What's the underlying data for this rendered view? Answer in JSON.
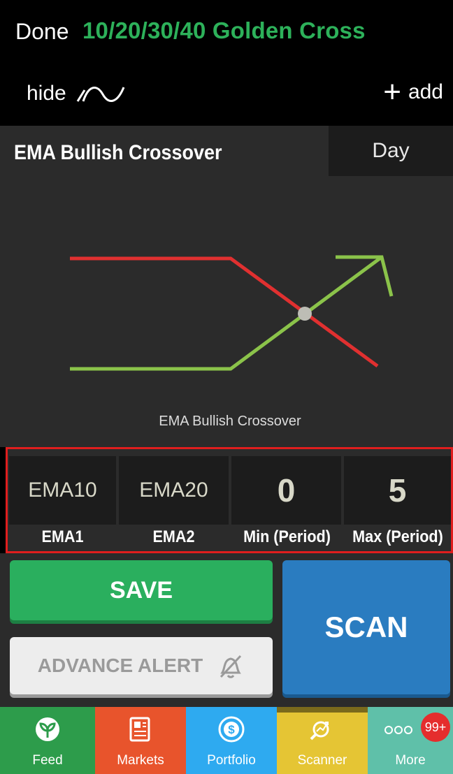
{
  "header": {
    "done_label": "Done",
    "strategy_title": "10/20/30/40 Golden Cross",
    "hide_label": "hide",
    "add_label": "add"
  },
  "criteria": {
    "name": "EMA Bullish Crossover",
    "period": "Day",
    "diagram_caption": "EMA Bullish Crossover"
  },
  "params": [
    {
      "value": "EMA10",
      "label": "EMA1"
    },
    {
      "value": "EMA20",
      "label": "EMA2"
    },
    {
      "value": "0",
      "label": "Min (Period)"
    },
    {
      "value": "5",
      "label": "Max (Period)"
    }
  ],
  "actions": {
    "save_label": "SAVE",
    "alert_label": "ADVANCE ALERT",
    "scan_label": "SCAN"
  },
  "tabs": [
    {
      "label": "Feed",
      "icon": "sprout-icon"
    },
    {
      "label": "Markets",
      "icon": "newspaper-icon"
    },
    {
      "label": "Portfolio",
      "icon": "dollar-coin-icon"
    },
    {
      "label": "Scanner",
      "icon": "magnifier-chart-icon"
    },
    {
      "label": "More",
      "icon": "more-dots-icon",
      "badge": "99+"
    }
  ],
  "colors": {
    "accent_green": "#2db15a",
    "highlight_red": "#e01e1e",
    "scan_blue": "#2a7cc0"
  }
}
